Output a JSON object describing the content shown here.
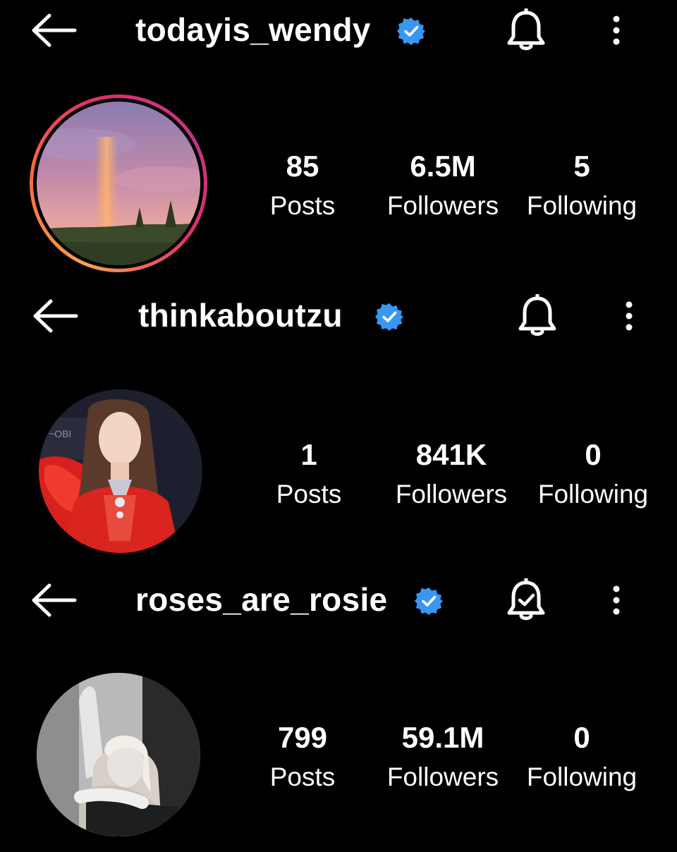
{
  "profiles": [
    {
      "username": "todayis_wendy",
      "verified": true,
      "bell_state": "off",
      "stats": [
        {
          "value": "85",
          "label": "Posts"
        },
        {
          "value": "6.5M",
          "label": "Followers"
        },
        {
          "value": "5",
          "label": "Following"
        }
      ],
      "avatar_description": "pink sky with rainbow",
      "has_story_ring": true
    },
    {
      "username": "thinkaboutzu",
      "verified": true,
      "bell_state": "off",
      "stats": [
        {
          "value": "1",
          "label": "Posts"
        },
        {
          "value": "841K",
          "label": "Followers"
        },
        {
          "value": "0",
          "label": "Following"
        }
      ],
      "avatar_description": "woman in red outfit",
      "has_story_ring": false
    },
    {
      "username": "roses_are_rosie",
      "verified": true,
      "bell_state": "on",
      "stats": [
        {
          "value": "799",
          "label": "Posts"
        },
        {
          "value": "59.1M",
          "label": "Followers"
        },
        {
          "value": "0",
          "label": "Following"
        }
      ],
      "avatar_description": "black and white portrait",
      "has_story_ring": false
    }
  ],
  "colors": {
    "background": "#000000",
    "text": "#ffffff",
    "verified_badge": "#3897f0"
  },
  "icons": [
    "back-arrow-icon",
    "verified-badge-icon",
    "bell-icon",
    "bell-check-icon",
    "more-options-icon"
  ]
}
